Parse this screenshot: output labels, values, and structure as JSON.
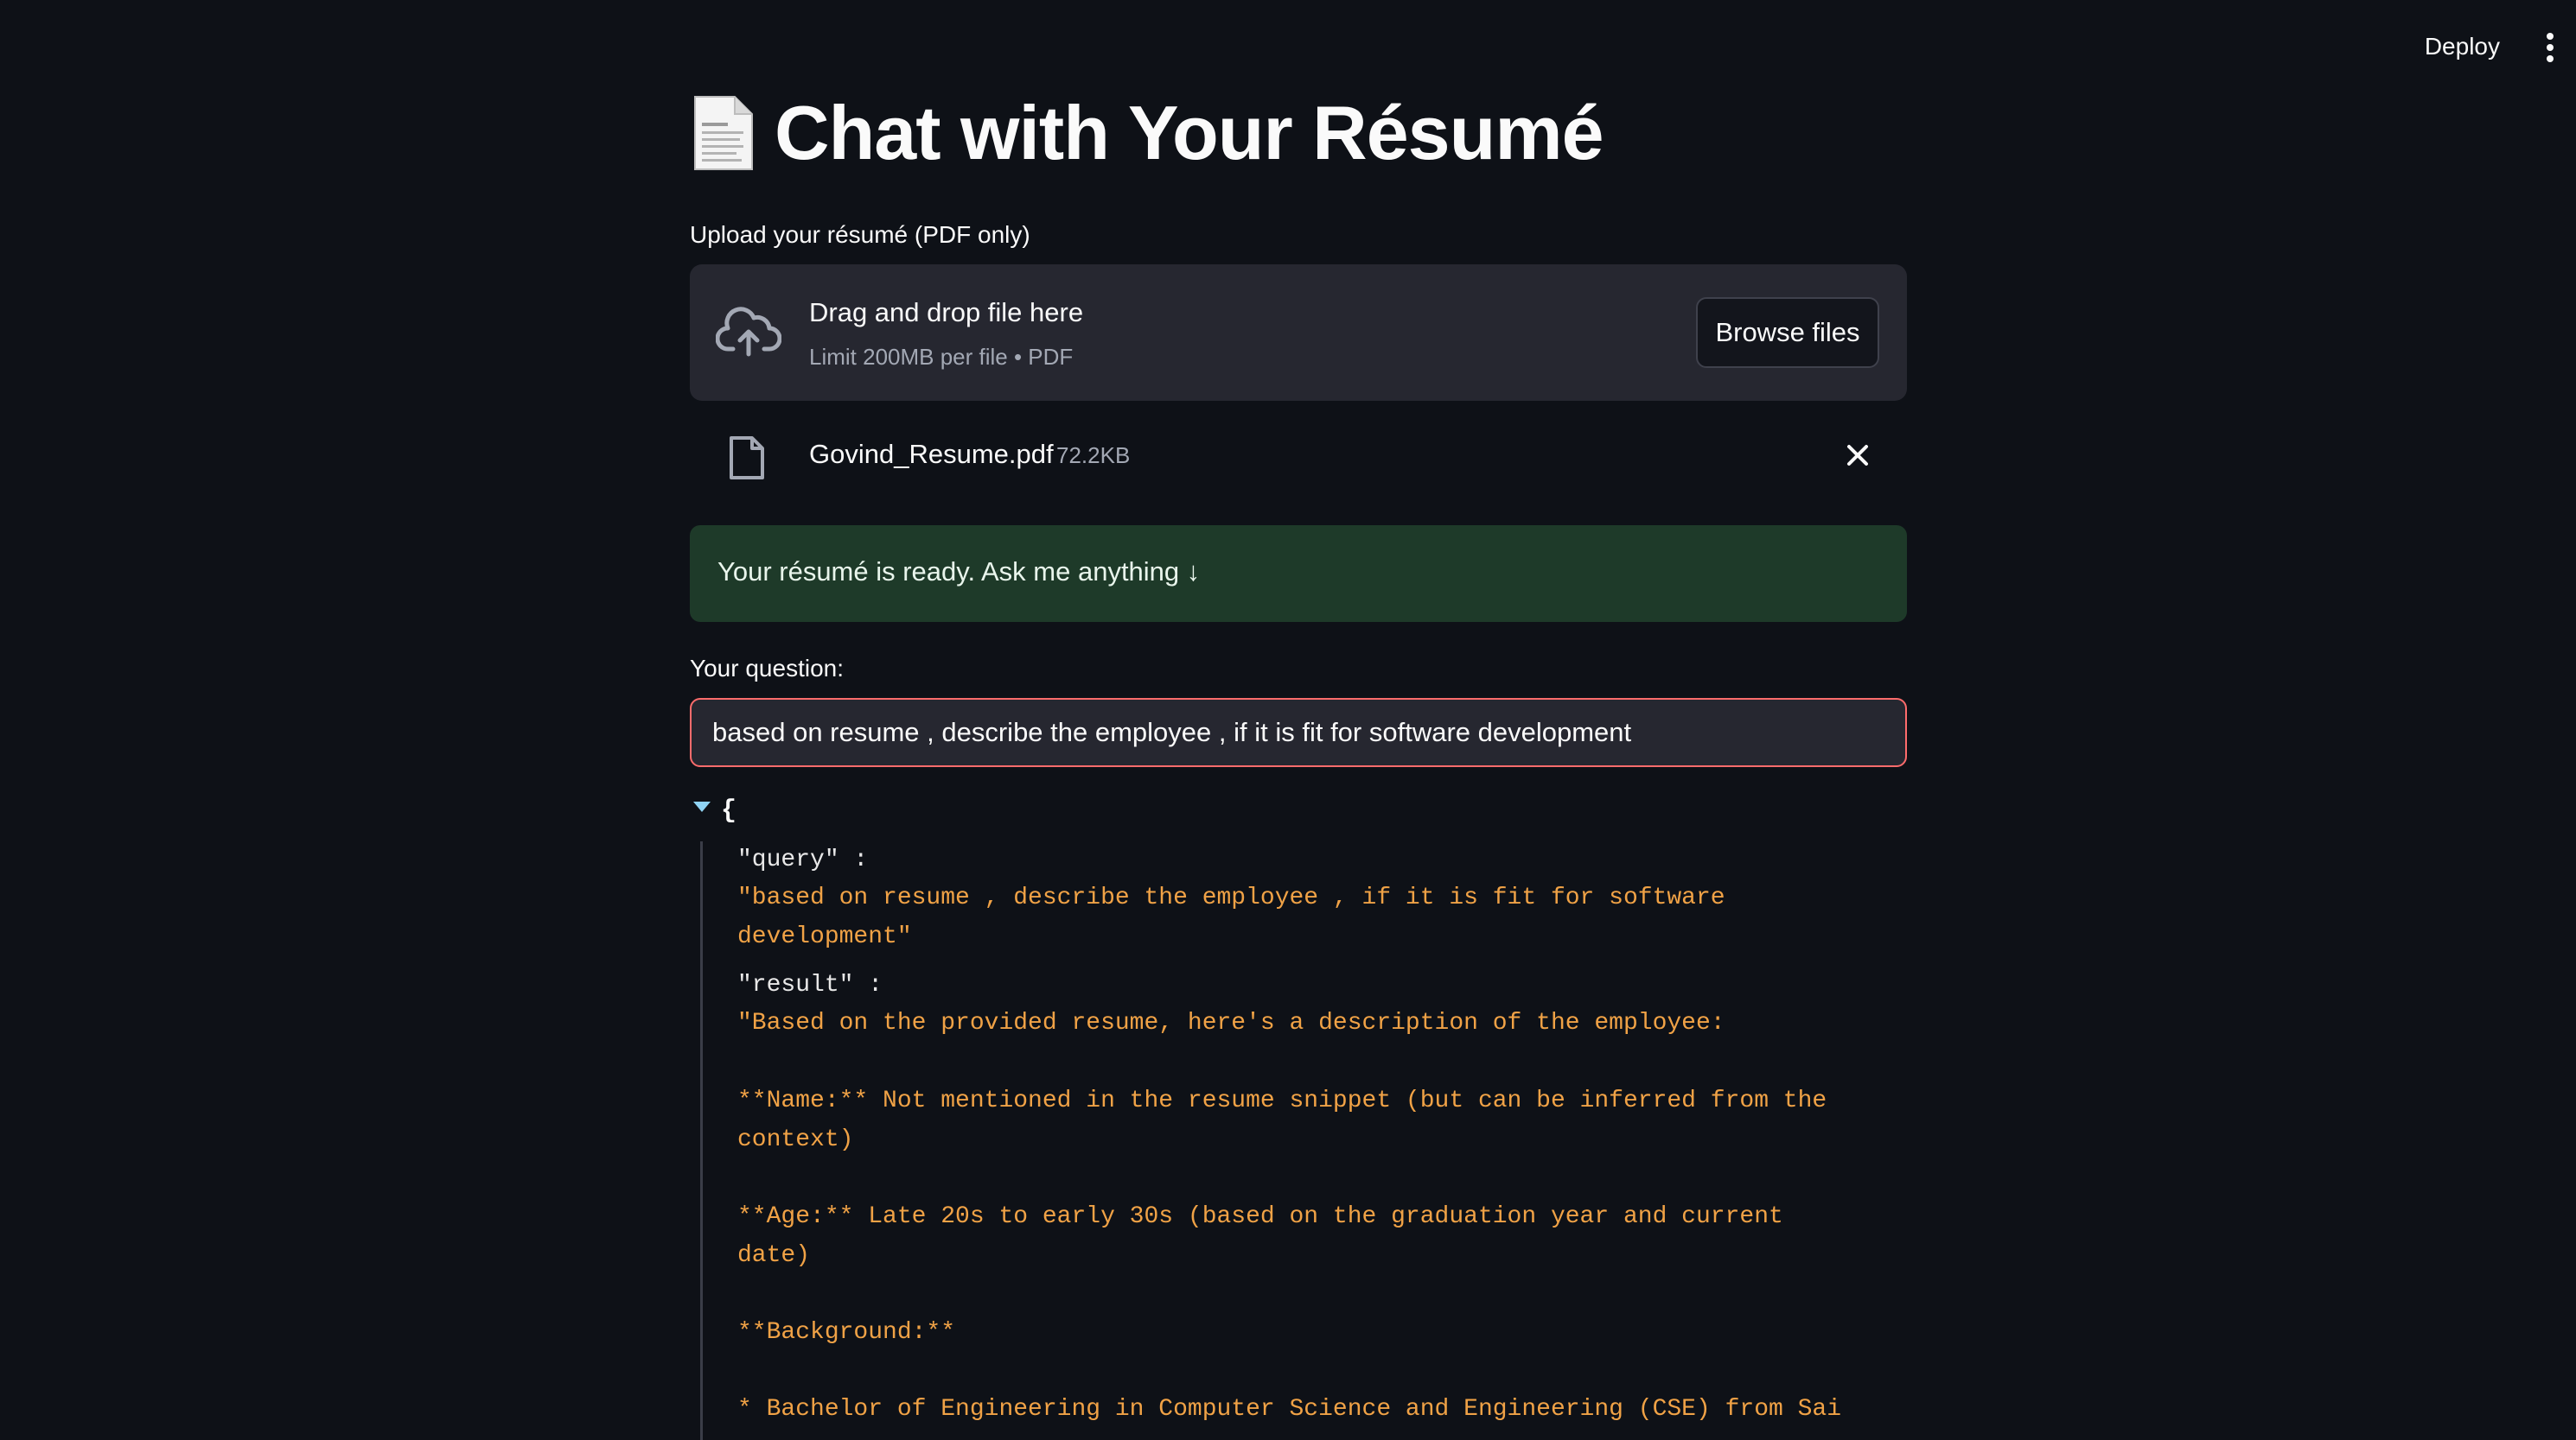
{
  "header": {
    "deploy_label": "Deploy",
    "menu_icon": "kebab-menu-icon"
  },
  "page": {
    "title_emoji": "document-icon",
    "title": "Chat with Your Résumé"
  },
  "uploader": {
    "label": "Upload your résumé (PDF only)",
    "drop_title": "Drag and drop file here",
    "drop_sub": "Limit 200MB per file • PDF",
    "browse_label": "Browse files",
    "icon": "cloud-upload-icon"
  },
  "file": {
    "name": "Govind_Resume.pdf",
    "size": "72.2KB",
    "icon": "file-icon",
    "remove_icon": "close-icon"
  },
  "success": {
    "text": "Your résumé is ready. Ask me anything ↓",
    "color": "#1e3a29"
  },
  "question": {
    "label": "Your question:",
    "value": "based on resume , describe the employee , if it is fit for software development",
    "border_color": "#ff6c6c"
  },
  "json_output": {
    "open_brace": "{",
    "query_key": "\"query\" :",
    "query_value": "\"based on resume , describe the employee , if it is fit for software development\"",
    "result_key": "\"result\" :",
    "result_value": "\"Based on the provided resume, here's a description of the employee:\n\n**Name:** Not mentioned in the resume snippet (but can be inferred from the context)\n\n**Age:** Late 20s to early 30s (based on the graduation year and current date)\n\n**Background:**\n\n* Bachelor of Engineering in Computer Science and Engineering (CSE) from Sai",
    "value_color": "#f0a246"
  }
}
